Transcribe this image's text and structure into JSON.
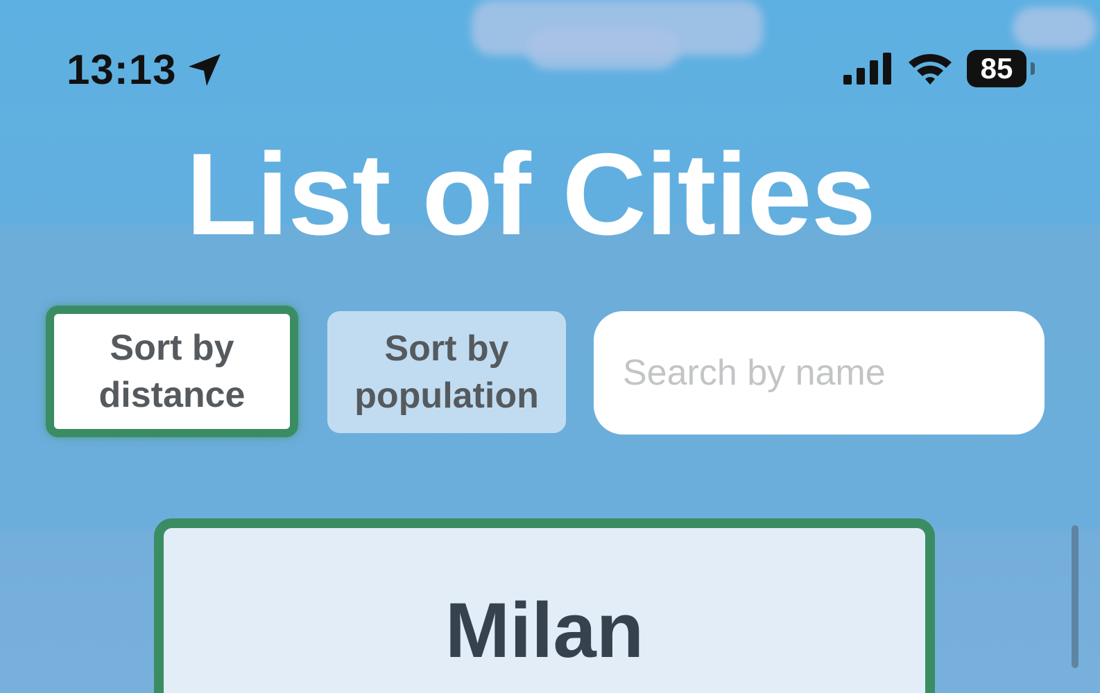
{
  "status_bar": {
    "time": "13:13",
    "battery": "85",
    "icons": [
      "location-arrow-icon",
      "cellular-signal-icon",
      "wifi-icon",
      "battery-icon"
    ]
  },
  "page": {
    "title": "List of Cities"
  },
  "controls": {
    "sort_distance_label": "Sort by\ndistance",
    "sort_population_label": "Sort by\npopulation",
    "active_sort": "distance",
    "search_placeholder": "Search by name",
    "search_value": ""
  },
  "cities": [
    {
      "name": "Milan"
    }
  ],
  "colors": {
    "sky": "#5db0e2",
    "title": "#ffffff",
    "accent_green": "#3a8d62",
    "card_bg": "#e3edf8",
    "inactive_button": "#c1dcf1"
  }
}
